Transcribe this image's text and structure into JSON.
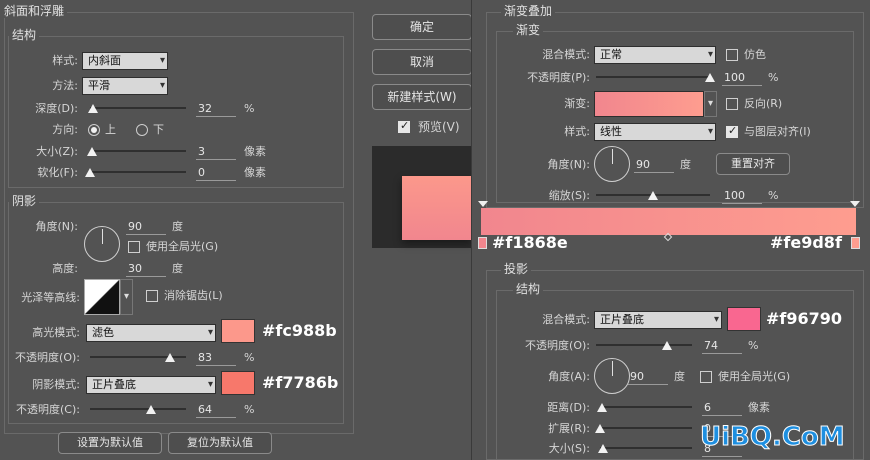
{
  "bevel": {
    "title": "斜面和浮雕",
    "structure": {
      "title": "结构",
      "style_label": "样式:",
      "style_value": "内斜面",
      "method_label": "方法:",
      "method_value": "平滑",
      "depth_label": "深度(D):",
      "depth_value": "32",
      "depth_unit": "%",
      "depth_pct": 0.032,
      "direction_label": "方向:",
      "dir_up": "上",
      "dir_down": "下",
      "size_label": "大小(Z):",
      "size_value": "3",
      "size_unit": "像素",
      "size_pct": 0.02,
      "soften_label": "软化(F):",
      "soften_value": "0",
      "soften_unit": "像素",
      "soften_pct": 0.0
    },
    "shading": {
      "title": "阴影",
      "angle_label": "角度(N):",
      "angle_value": "90",
      "angle_unit": "度",
      "global_light_label": "使用全局光(G)",
      "altitude_label": "高度:",
      "altitude_value": "30",
      "altitude_unit": "度",
      "gloss_label": "光泽等高线:",
      "antialias_label": "消除锯齿(L)",
      "highlight_mode_label": "高光模式:",
      "highlight_mode_value": "滤色",
      "highlight_color": "#fc988b",
      "highlight_hex": "#fc988b",
      "highlight_opacity_label": "不透明度(O):",
      "highlight_opacity_value": "83",
      "highlight_opacity_unit": "%",
      "highlight_opacity_pct": 0.83,
      "shadow_mode_label": "阴影模式:",
      "shadow_mode_value": "正片叠底",
      "shadow_color": "#f7786b",
      "shadow_hex": "#f7786b",
      "shadow_opacity_label": "不透明度(C):",
      "shadow_opacity_value": "64",
      "shadow_opacity_unit": "%",
      "shadow_opacity_pct": 0.64
    },
    "set_default": "设置为默认值",
    "reset_default": "复位为默认值"
  },
  "buttons": {
    "ok": "确定",
    "cancel": "取消",
    "new_style": "新建样式(W)",
    "preview": "预览(V)"
  },
  "preview_colors": {
    "top": "#fc988b",
    "bottom": "#f1868e"
  },
  "gradient_overlay": {
    "title": "渐变叠加",
    "sub_title": "渐变",
    "blend_label": "混合模式:",
    "blend_value": "正常",
    "dither_label": "仿色",
    "opacity_label": "不透明度(P):",
    "opacity_value": "100",
    "opacity_unit": "%",
    "opacity_pct": 1.0,
    "gradient_label": "渐变:",
    "reverse_label": "反向(R)",
    "style_label": "样式:",
    "style_value": "线性",
    "align_label": "与图层对齐(I)",
    "angle_label": "角度(N):",
    "angle_value": "90",
    "angle_unit": "度",
    "reset_align": "重置对齐",
    "scale_label": "缩放(S):",
    "scale_value": "100",
    "scale_unit": "%",
    "scale_pct": 0.5,
    "stop_left_hex": "#f1868e",
    "stop_right_hex": "#fe9d8f",
    "color_left": "#f1868e",
    "color_right": "#fe9d8f"
  },
  "drop_shadow": {
    "title": "投影",
    "sub_title": "结构",
    "blend_label": "混合模式:",
    "blend_value": "正片叠底",
    "color": "#f96790",
    "hex": "#f96790",
    "opacity_label": "不透明度(O):",
    "opacity_value": "74",
    "opacity_unit": "%",
    "opacity_pct": 0.74,
    "angle_label": "角度(A):",
    "angle_value": "90",
    "angle_unit": "度",
    "global_light_label": "使用全局光(G)",
    "distance_label": "距离(D):",
    "distance_value": "6",
    "distance_unit": "像素",
    "distance_pct": 0.02,
    "spread_label": "扩展(R):",
    "spread_value": "0",
    "spread_pct": 0.0,
    "size_label": "大小(S):",
    "size_value": "8",
    "size_pct": 0.03
  },
  "watermark": "UiBQ.CoM"
}
